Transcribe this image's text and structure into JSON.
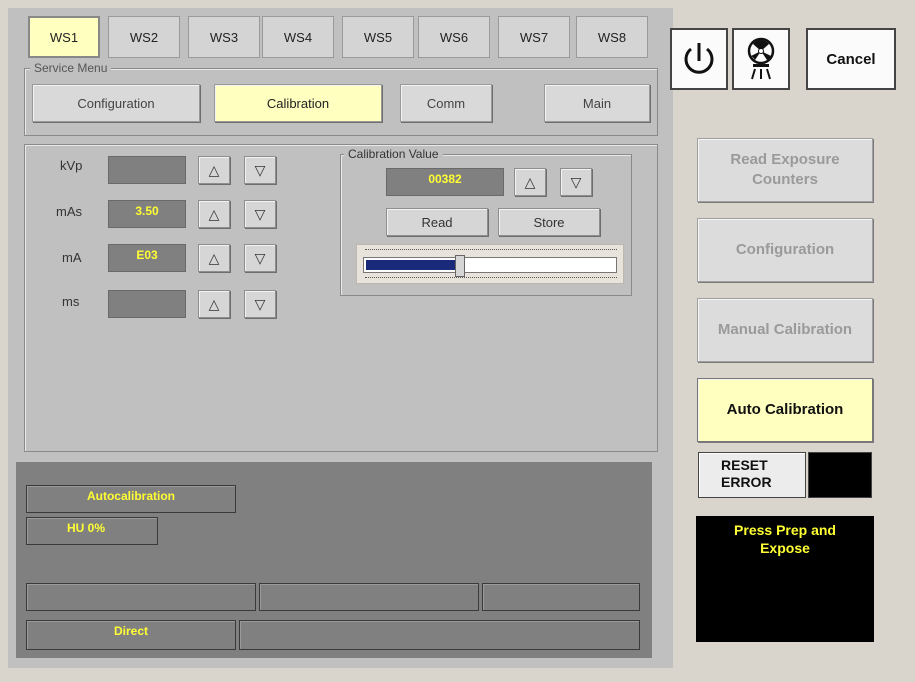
{
  "tabs": [
    {
      "label": "WS1",
      "active": true
    },
    {
      "label": "WS2",
      "active": false
    },
    {
      "label": "WS3",
      "active": false
    },
    {
      "label": "WS4",
      "active": false
    },
    {
      "label": "WS5",
      "active": false
    },
    {
      "label": "WS6",
      "active": false
    },
    {
      "label": "WS7",
      "active": false
    },
    {
      "label": "WS8",
      "active": false
    }
  ],
  "service_menu": {
    "legend": "Service Menu",
    "buttons": [
      {
        "label": "Configuration",
        "active": false
      },
      {
        "label": "Calibration",
        "active": true
      },
      {
        "label": "Comm",
        "active": false
      },
      {
        "label": "Main",
        "active": false
      }
    ]
  },
  "params": [
    {
      "label": "kVp",
      "value": ""
    },
    {
      "label": "mAs",
      "value": "3.50"
    },
    {
      "label": "mA",
      "value": "E03"
    },
    {
      "label": "ms",
      "value": ""
    }
  ],
  "arrows": {
    "up": "△",
    "down": "▽"
  },
  "calibration": {
    "legend": "Calibration Value",
    "value": "00382",
    "read_label": "Read",
    "store_label": "Store",
    "slider_level": 0.37
  },
  "status": {
    "mode": "Autocalibration",
    "hu": "HU 0%",
    "cells": [
      "",
      "",
      ""
    ],
    "direct": "Direct",
    "direct_info": ""
  },
  "right": {
    "cancel_label": "Cancel",
    "read_exposure_label": "Read Exposure Counters",
    "configuration_label": "Configuration",
    "manual_calibration_label": "Manual Calibration",
    "auto_calibration_label": "Auto Calibration",
    "reset_error_label": "RESET ERROR",
    "message": "Press Prep and Expose",
    "power_icon": "power-icon",
    "radiation_icon": "radiation-icon"
  },
  "colors": {
    "active_yellow": "#ffffc0",
    "readout_text": "#ffff33",
    "panel_grey": "#c0c0c0",
    "status_bg": "#808080"
  }
}
